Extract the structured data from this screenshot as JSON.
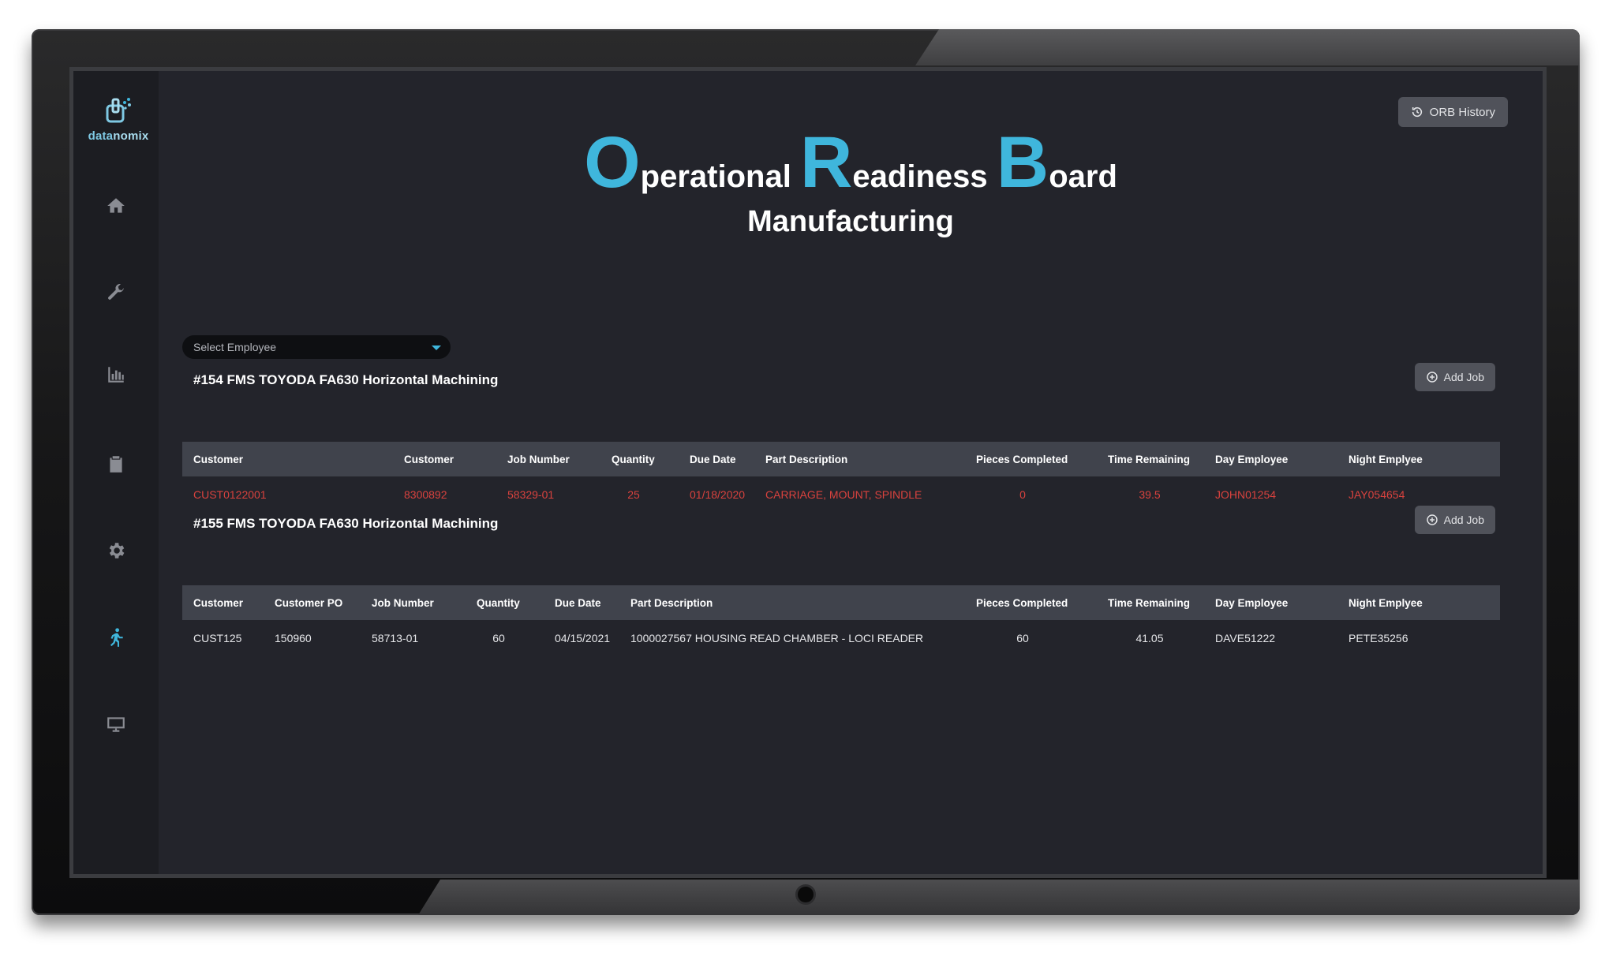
{
  "brand": {
    "logo_text_a": "data",
    "logo_text_b": "nomix"
  },
  "header": {
    "orb_history_label": "ORB History",
    "title_o": "O",
    "title_perational": "perational",
    "title_r": "R",
    "title_eadiness": "eadiness",
    "title_b": "B",
    "title_oard": "oard",
    "subtitle": "Manufacturing"
  },
  "filter": {
    "select_employee_placeholder": "Select Employee"
  },
  "colors": {
    "accent": "#3fb6dc",
    "late_text": "#d9423e",
    "screen_bg": "#23242b"
  },
  "sidebar": {
    "icons": [
      "home-icon",
      "wrench-icon",
      "bar-chart-icon",
      "clipboard-icon",
      "gear-icon",
      "walking-person-icon",
      "monitor-icon"
    ],
    "active": "walking-person-icon"
  },
  "machines": [
    {
      "title": "#154 FMS TOYODA FA630 Horizontal Machining",
      "add_job_label": "Add Job",
      "status": "late",
      "columns": [
        "Customer",
        "Customer",
        "Job Number",
        "Quantity",
        "Due Date",
        "Part Description",
        "Pieces Completed",
        "Time Remaining",
        "Day Employee",
        "Night Emplyee"
      ],
      "rows": [
        [
          "CUST0122001",
          "8300892",
          "58329-01",
          "25",
          "01/18/2020",
          "CARRIAGE, MOUNT, SPINDLE",
          "0",
          "39.5",
          "JOHN01254",
          "JAY054654"
        ]
      ]
    },
    {
      "title": "#155 FMS TOYODA FA630 Horizontal Machining",
      "add_job_label": "Add Job",
      "status": "normal",
      "columns": [
        "Customer",
        "Customer PO",
        "Job Number",
        "Quantity",
        "Due Date",
        "Part Description",
        "Pieces Completed",
        "Time Remaining",
        "Day Employee",
        "Night Emplyee"
      ],
      "rows": [
        [
          "CUST125",
          "150960",
          "58713-01",
          "60",
          "04/15/2021",
          "1000027567 HOUSING READ CHAMBER - LOCI READER",
          "60",
          "41.05",
          "DAVE51222",
          "PETE35256"
        ]
      ]
    }
  ]
}
